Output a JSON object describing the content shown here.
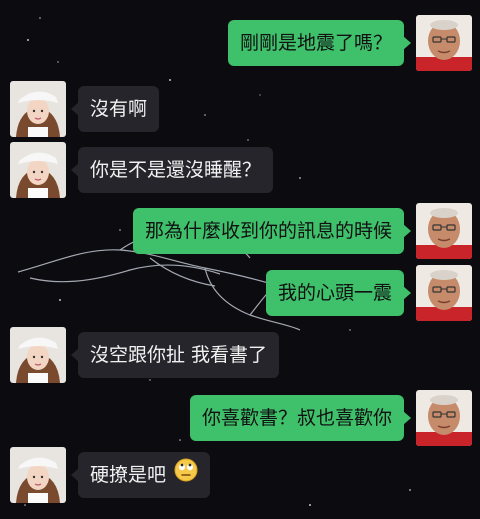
{
  "conversation": {
    "messages": [
      {
        "sender": "uncle",
        "direction": "out",
        "text": "剛剛是地震了嗎？"
      },
      {
        "sender": "girl",
        "direction": "in",
        "text": "沒有啊"
      },
      {
        "sender": "girl",
        "direction": "in",
        "text": "你是不是還沒睡醒？"
      },
      {
        "sender": "uncle",
        "direction": "out",
        "text": "那為什麼收到你的訊息的時候"
      },
      {
        "sender": "uncle",
        "direction": "out",
        "text": "我的心頭一震"
      },
      {
        "sender": "girl",
        "direction": "in",
        "text": "沒空跟你扯 我看書了"
      },
      {
        "sender": "uncle",
        "direction": "out",
        "text": "你喜歡書？叔也喜歡你"
      },
      {
        "sender": "girl",
        "direction": "in",
        "text": "硬撩是吧",
        "emoji": "eye-roll-emoji"
      }
    ]
  },
  "colors": {
    "background": "#0b0b10",
    "outgoing_bubble": "#3fc06b",
    "incoming_bubble": "#25252b",
    "uncle_shirt": "#c8242a"
  }
}
